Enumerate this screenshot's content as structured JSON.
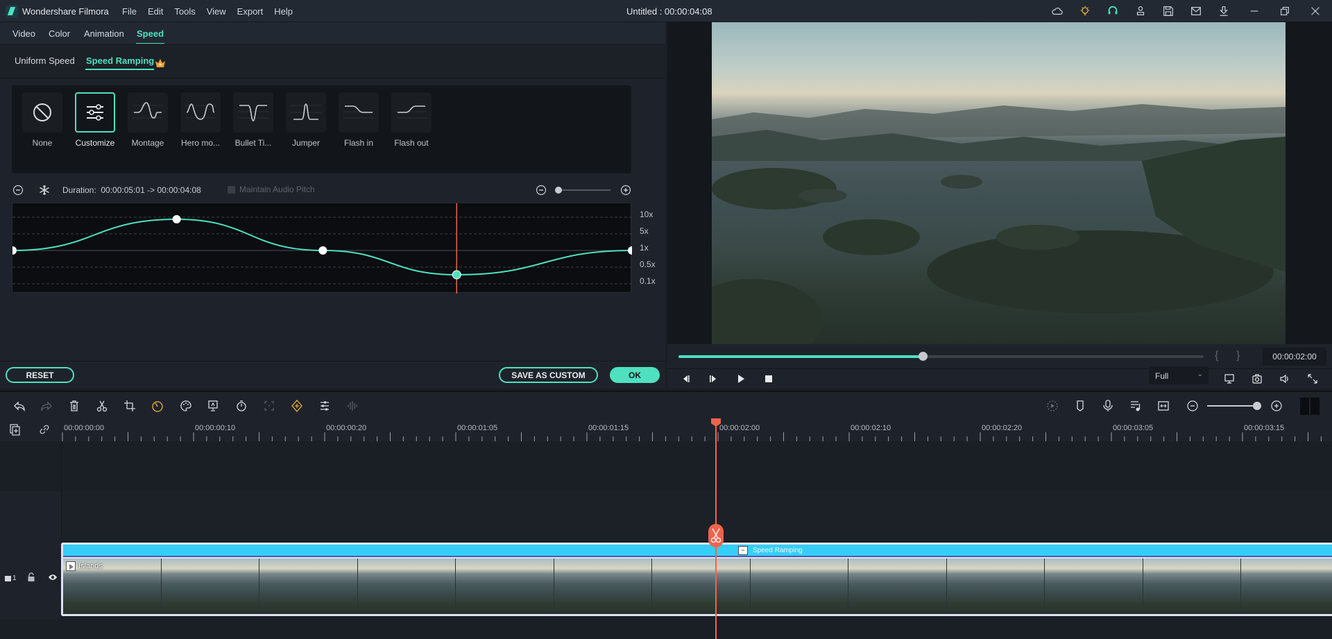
{
  "app": {
    "name": "Wondershare Filmora",
    "menu": [
      "File",
      "Edit",
      "Tools",
      "View",
      "Export",
      "Help"
    ],
    "document_title": "Untitled : 00:00:04:08",
    "title_icons": [
      "cloud-icon",
      "lightbulb-icon",
      "headset-icon",
      "account-icon",
      "save-icon",
      "mail-icon",
      "download-icon",
      "minimize-icon",
      "restore-icon",
      "close-icon"
    ]
  },
  "editor": {
    "tabs": [
      "Video",
      "Color",
      "Animation",
      "Speed"
    ],
    "active_tab": "Speed",
    "subtabs": [
      "Uniform Speed",
      "Speed Ramping"
    ],
    "active_subtab": "Speed Ramping",
    "presets": [
      {
        "label": "None",
        "icon": "none-icon"
      },
      {
        "label": "Customize",
        "icon": "sliders-icon",
        "selected": true
      },
      {
        "label": "Montage",
        "icon": "montage-curve-icon"
      },
      {
        "label": "Hero mo...",
        "icon": "hero-moment-curve-icon"
      },
      {
        "label": "Bullet Ti...",
        "icon": "bullet-time-curve-icon"
      },
      {
        "label": "Jumper",
        "icon": "jumper-curve-icon"
      },
      {
        "label": "Flash in",
        "icon": "flash-in-curve-icon"
      },
      {
        "label": "Flash out",
        "icon": "flash-out-curve-icon"
      }
    ],
    "duration_label": "Duration:",
    "duration_value": "00:00:05:01 -> 00:00:04:08",
    "maintain_audio_pitch": {
      "label": "Maintain Audio Pitch",
      "checked": false,
      "enabled": false
    },
    "curve_zoom_level": 0,
    "speed_labels": [
      "10x",
      "5x",
      "1x",
      "0.5x",
      "0.1x"
    ],
    "speed_points": [
      {
        "t": 0.0,
        "speed": "1x"
      },
      {
        "t": 0.265,
        "speed": "~8x"
      },
      {
        "t": 0.501,
        "speed": "1x"
      },
      {
        "t": 0.717,
        "speed": "~0.3x",
        "selected": true
      },
      {
        "t": 1.0,
        "speed": "1x"
      }
    ],
    "playhead_t": 0.717,
    "buttons": {
      "reset": "RESET",
      "save_as_custom": "SAVE AS CUSTOM",
      "ok": "OK"
    }
  },
  "preview": {
    "progress": 0.465,
    "timecode": "00:00:02:00",
    "mark_in": "{",
    "mark_out": "}",
    "quality": "Full"
  },
  "timeline": {
    "ruler_labels": [
      "00:00:00:00",
      "00:00:00:10",
      "00:00:00:20",
      "00:00:01:05",
      "00:00:01:15",
      "00:00:02:00",
      "00:00:02:10",
      "00:00:02:20",
      "00:00:03:05",
      "00:00:03:15"
    ],
    "playhead_time": "00:00:02:00",
    "track": {
      "number": "1"
    },
    "clip": {
      "name": "Islands",
      "effect_label": "Speed Ramping"
    }
  },
  "colors": {
    "accent": "#4fe0c0",
    "playhead": "#f0634c",
    "clip_bar": "#35cef8"
  }
}
